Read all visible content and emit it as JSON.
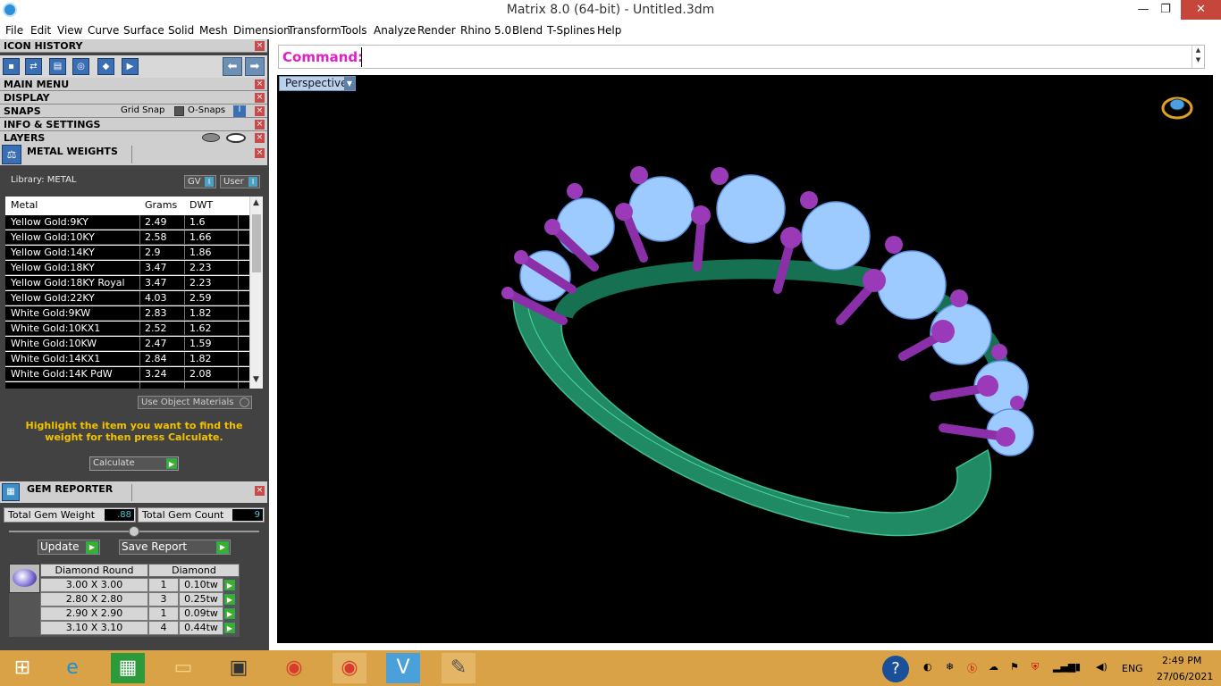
{
  "window": {
    "title": "Matrix 8.0 (64-bit) - Untitled.3dm",
    "minimize": "—",
    "maximize": "❐",
    "close": "✕"
  },
  "menu": [
    "File",
    "Edit",
    "View",
    "Curve",
    "Surface",
    "Solid",
    "Mesh",
    "Dimension",
    "Transform",
    "Tools",
    "Analyze",
    "Render",
    "Rhino 5.0",
    "Blend",
    "T-Splines",
    "Help"
  ],
  "panels": {
    "icon_history": "ICON HISTORY",
    "main_menu": "MAIN MENU",
    "display": "DISPLAY",
    "snaps": "SNAPS",
    "grid_snap": "Grid Snap",
    "o_snaps": "O-Snaps",
    "info_settings": "INFO & SETTINGS",
    "layers": "LAYERS"
  },
  "metal_weights": {
    "title": "METAL WEIGHTS",
    "library_label": "Library: METAL",
    "gv_button": "GV",
    "user_button": "User",
    "columns": [
      "Metal",
      "Grams",
      "DWT"
    ],
    "rows": [
      {
        "metal": "Yellow Gold:9KY",
        "grams": "2.49",
        "dwt": "1.6"
      },
      {
        "metal": "Yellow Gold:10KY",
        "grams": "2.58",
        "dwt": "1.66"
      },
      {
        "metal": "Yellow Gold:14KY",
        "grams": "2.9",
        "dwt": "1.86"
      },
      {
        "metal": "Yellow Gold:18KY",
        "grams": "3.47",
        "dwt": "2.23"
      },
      {
        "metal": "Yellow Gold:18KY Royal",
        "grams": "3.47",
        "dwt": "2.23"
      },
      {
        "metal": "Yellow Gold:22KY",
        "grams": "4.03",
        "dwt": "2.59"
      },
      {
        "metal": "White Gold:9KW",
        "grams": "2.83",
        "dwt": "1.82"
      },
      {
        "metal": "White Gold:10KX1",
        "grams": "2.52",
        "dwt": "1.62"
      },
      {
        "metal": "White Gold:10KW",
        "grams": "2.47",
        "dwt": "1.59"
      },
      {
        "metal": "White Gold:14KX1",
        "grams": "2.84",
        "dwt": "1.82"
      },
      {
        "metal": "White Gold:14K PdW",
        "grams": "3.24",
        "dwt": "2.08"
      }
    ],
    "use_object_materials": "Use Object Materials",
    "hint": "Highlight the item you want to find the weight for then press Calculate.",
    "calculate_button": "Calculate"
  },
  "gem_reporter": {
    "title": "GEM REPORTER",
    "total_weight_label": "Total Gem Weight",
    "total_weight_value": ".88",
    "total_count_label": "Total Gem Count",
    "total_count_value": "9",
    "update_button": "Update",
    "save_report_button": "Save Report",
    "columns": [
      "Diamond Round",
      "Diamond"
    ],
    "rows": [
      {
        "size": "3.00 X 3.00",
        "count": "1",
        "weight": "0.10tw"
      },
      {
        "size": "2.80 X 2.80",
        "count": "3",
        "weight": "0.25tw"
      },
      {
        "size": "2.90 X 2.90",
        "count": "1",
        "weight": "0.09tw"
      },
      {
        "size": "3.10 X 3.10",
        "count": "4",
        "weight": "0.44tw"
      }
    ]
  },
  "command": {
    "label": "Command:",
    "value": ""
  },
  "viewport": {
    "name": "Perspective"
  },
  "colors": {
    "metal": "#1f8a63",
    "gem": "#9ecbff",
    "prong": "#8a2fa8",
    "hint": "#f2c200",
    "command": "#e020c0"
  },
  "taskbar": {
    "icons": [
      "windows-start-icon",
      "internet-explorer-icon",
      "store-icon",
      "file-explorer-icon",
      "matrix-app-icon",
      "chrome-icon",
      "chrome-icon",
      "vs-icon",
      "paint-icon"
    ],
    "language": "ENG",
    "time": "2:49 PM",
    "date": "27/06/2021"
  }
}
